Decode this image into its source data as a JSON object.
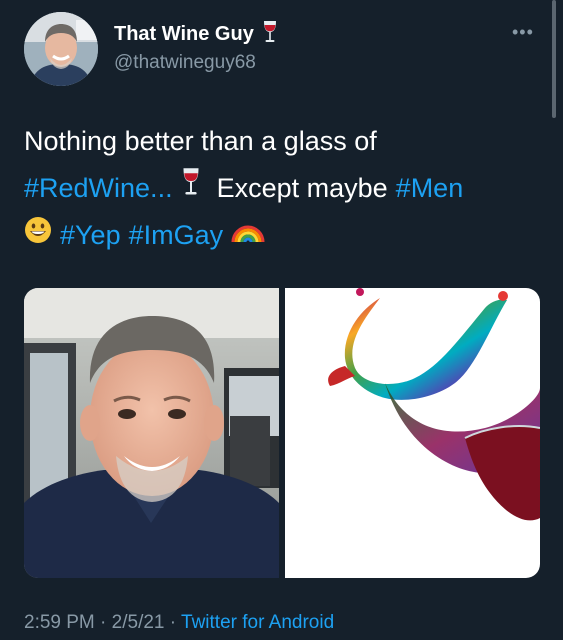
{
  "author": {
    "display_name": "That Wine Guy",
    "display_name_emoji": "wine-glass-icon",
    "handle": "@thatwineguy68"
  },
  "menu": {
    "more_label": "•••"
  },
  "tweet": {
    "line1": {
      "text": "Nothing better than a glass of"
    },
    "line2": {
      "tag1": "#RedWine...",
      "emoji1": "wine-glass-icon",
      "text": "Except maybe",
      "tag2": "#Men"
    },
    "line3": {
      "emoji1": "grinning-face-icon",
      "tag1": "#Yep",
      "tag2": "#ImGay",
      "emoji2": "rainbow-icon"
    }
  },
  "media": {
    "photo1": "selfie-photo",
    "photo2": "rainbow-wine-splash-image"
  },
  "footer": {
    "time": "2:59 PM",
    "sep1": " · ",
    "date": "2/5/21",
    "sep2": " · ",
    "source": "Twitter for Android"
  },
  "colors": {
    "background": "#15202b",
    "link": "#1da1f2",
    "secondary_text": "#8899a6"
  }
}
